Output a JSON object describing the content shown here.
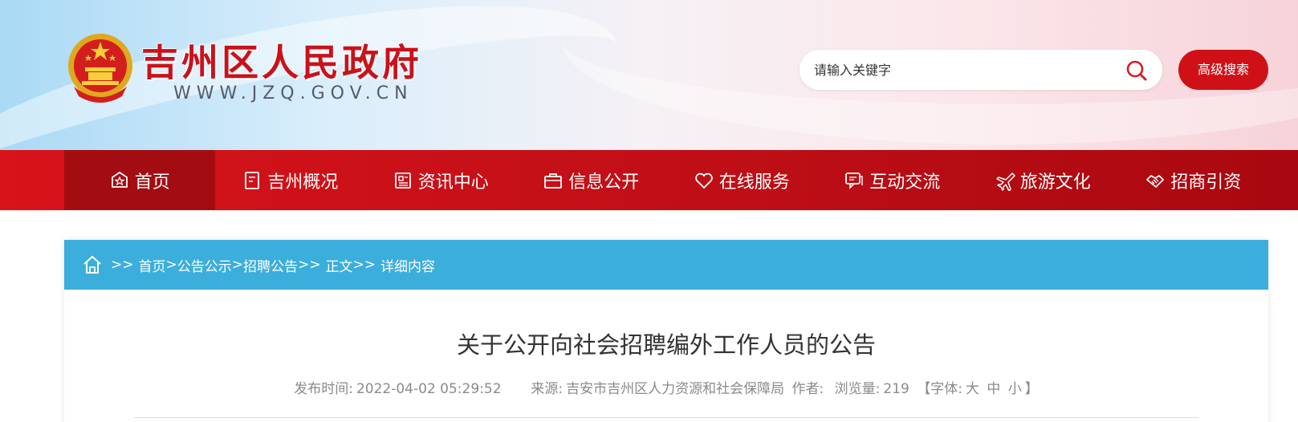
{
  "header": {
    "site_title": "吉州区人民政府",
    "site_url": "WWW.JZQ.GOV.CN",
    "emblem_icon": "national-emblem-icon",
    "search_placeholder": "请输入关键字",
    "advanced_search_label": "高级搜索"
  },
  "nav": {
    "items": [
      {
        "label": "首页",
        "icon": "home-badge-icon",
        "active": true
      },
      {
        "label": "吉州概况",
        "icon": "document-icon",
        "active": false
      },
      {
        "label": "资讯中心",
        "icon": "news-icon",
        "active": false
      },
      {
        "label": "信息公开",
        "icon": "briefcase-icon",
        "active": false
      },
      {
        "label": "在线服务",
        "icon": "heart-icon",
        "active": false
      },
      {
        "label": "互动交流",
        "icon": "chat-icon",
        "active": false
      },
      {
        "label": "旅游文化",
        "icon": "airplane-icon",
        "active": false
      },
      {
        "label": "招商引资",
        "icon": "handshake-icon",
        "active": false
      }
    ]
  },
  "breadcrumb": {
    "lead": ">>",
    "home": "首页",
    "sep1": ">",
    "notice": "公告公示",
    "sep2": ">",
    "recruit": "招聘公告",
    "sep3": ">>",
    "body": "正文",
    "sep4": ">>",
    "detail": "详细内容"
  },
  "article": {
    "title": "关于公开向社会招聘编外工作人员的公告",
    "published_label": "发布时间:",
    "published_value": "2022-04-02 05:29:52",
    "source_label": "来源:",
    "source_value": "吉安市吉州区人力资源和社会保障局",
    "author_label": "作者:",
    "author_value": "",
    "views_label": "浏览量:",
    "views_value": "219",
    "font_open": "【字体:",
    "font_large": "大",
    "font_medium": "中",
    "font_small": "小",
    "font_close": "】"
  },
  "colors": {
    "nav_red": "#c20f17",
    "nav_active": "#a30d12",
    "title_red": "#c9121b",
    "crumb_blue": "#3caedc",
    "search_button": "#cf1117"
  }
}
